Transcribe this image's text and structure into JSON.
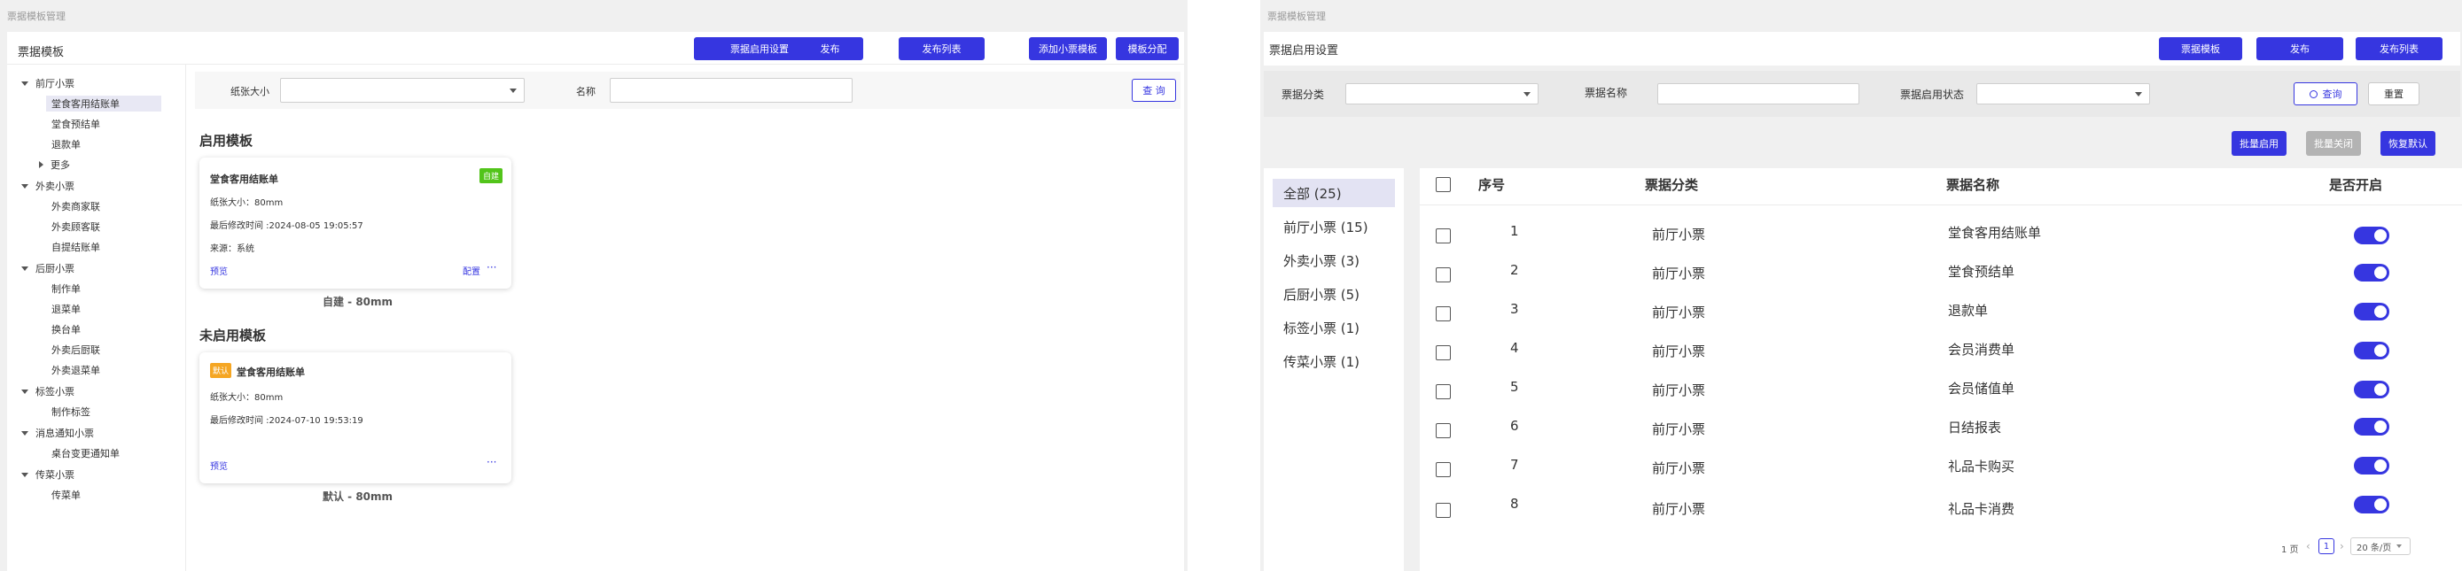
{
  "left": {
    "window_title": "票据模板管理",
    "header_title": "票据模板",
    "header_buttons": [
      "票据启用设置",
      "发布",
      "发布列表",
      "添加小票模板",
      "模板分配"
    ],
    "tree": [
      {
        "label": "前厅小票",
        "level": 0,
        "expanded": true
      },
      {
        "label": "堂食客用结账单",
        "level": 1,
        "selected": true
      },
      {
        "label": "堂食预结单",
        "level": 1
      },
      {
        "label": "退款单",
        "level": 1
      },
      {
        "label": "更多",
        "level": 1,
        "expandable": true
      },
      {
        "label": "外卖小票",
        "level": 0,
        "expanded": true
      },
      {
        "label": "外卖商家联",
        "level": 1
      },
      {
        "label": "外卖顾客联",
        "level": 1
      },
      {
        "label": "自提结账单",
        "level": 1
      },
      {
        "label": "后厨小票",
        "level": 0,
        "expanded": true
      },
      {
        "label": "制作单",
        "level": 1
      },
      {
        "label": "退菜单",
        "level": 1
      },
      {
        "label": "换台单",
        "level": 1
      },
      {
        "label": "外卖后厨联",
        "level": 1
      },
      {
        "label": "外卖退菜单",
        "level": 1
      },
      {
        "label": "标签小票",
        "level": 0,
        "expanded": true
      },
      {
        "label": "制作标签",
        "level": 1
      },
      {
        "label": "消息通知小票",
        "level": 0,
        "expanded": true
      },
      {
        "label": "桌台变更通知单",
        "level": 1
      },
      {
        "label": "传菜小票",
        "level": 0,
        "expanded": true
      },
      {
        "label": "传菜单",
        "level": 1
      }
    ],
    "filter": {
      "paper_size_label": "纸张大小",
      "name_label": "名称",
      "query_button": "查 询"
    },
    "enabled_section_title": "启用模板",
    "disabled_section_title": "未启用模板",
    "enabled_card": {
      "title": "堂食客用结账单",
      "badge": "自建",
      "badge_color": "#52c41a",
      "paper_size": "纸张大小：80mm",
      "modified": "最后修改时间 :2024-08-05 19:05:57",
      "source": "来源：系统",
      "preview": "预览",
      "configure": "配置",
      "more": "···",
      "caption": "自建 - 80mm"
    },
    "disabled_card": {
      "title": "堂食客用结账单",
      "badge": "默认",
      "badge_color": "#f5a623",
      "paper_size": "纸张大小：80mm",
      "modified": "最后修改时间 :2024-07-10 19:53:19",
      "preview": "预览",
      "more": "···",
      "caption": "默认 - 80mm"
    }
  },
  "right": {
    "window_title": "票据模板管理",
    "header_title": "票据启用设置",
    "header_buttons": [
      "票据模板",
      "发布",
      "发布列表"
    ],
    "filters": {
      "category_label": "票据分类",
      "name_label": "票据名称",
      "status_label": "票据启用状态",
      "query_button": "查询",
      "reset_button": "重置"
    },
    "action_buttons": {
      "batch_enable": "批量启用",
      "batch_disable": "批量关闭",
      "restore_default": "恢复默认"
    },
    "categories": [
      {
        "label": "全部 (25)",
        "selected": true
      },
      {
        "label": "前厅小票 (15)"
      },
      {
        "label": "外卖小票 (3)"
      },
      {
        "label": "后厨小票 (5)"
      },
      {
        "label": "标签小票 (1)"
      },
      {
        "label": "传菜小票 (1)"
      }
    ],
    "table": {
      "columns": [
        "序号",
        "票据分类",
        "票据名称",
        "是否开启"
      ],
      "rows": [
        {
          "index": "1",
          "category": "前厅小票",
          "name": "堂食客用结账单",
          "enabled": true
        },
        {
          "index": "2",
          "category": "前厅小票",
          "name": "堂食预结单",
          "enabled": true
        },
        {
          "index": "3",
          "category": "前厅小票",
          "name": "退款单",
          "enabled": true
        },
        {
          "index": "4",
          "category": "前厅小票",
          "name": "会员消费单",
          "enabled": true
        },
        {
          "index": "5",
          "category": "前厅小票",
          "name": "会员储值单",
          "enabled": true
        },
        {
          "index": "6",
          "category": "前厅小票",
          "name": "日结报表",
          "enabled": true
        },
        {
          "index": "7",
          "category": "前厅小票",
          "name": "礼品卡购买",
          "enabled": true
        },
        {
          "index": "8",
          "category": "前厅小票",
          "name": "礼品卡消费",
          "enabled": true
        }
      ]
    },
    "pagination": {
      "total": "1 页",
      "prev": "‹",
      "current_page": "1",
      "next": "›",
      "page_size": "20 条/页"
    },
    "colors": {
      "primary": "#3636e0",
      "toggle_on": "#3636e0",
      "selected_category_bg": "#e3e3f3"
    }
  }
}
